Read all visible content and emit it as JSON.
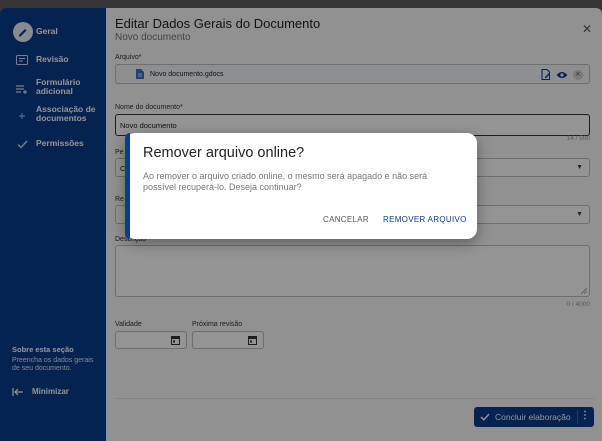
{
  "sidebar": {
    "items": [
      {
        "label": "Geral"
      },
      {
        "label": "Revisão"
      },
      {
        "label_line1": "Formulário",
        "label_line2": "adicional"
      },
      {
        "label_line1": "Associação de",
        "label_line2": "documentos"
      },
      {
        "label": "Permissões"
      }
    ],
    "about_title": "Sobre esta seção",
    "about_text": "Preencha os dados gerais de seu documento.",
    "minimize_label": "Minimizar"
  },
  "panel": {
    "title": "Editar Dados Gerais do Documento",
    "subtitle": "Novo documento",
    "close_icon": "close-icon",
    "fields": {
      "arquivo_label": "Arquivo*",
      "arquivo_value": "Novo documento.gdocs",
      "nome_label": "Nome do documento*",
      "nome_value": "Novo documento",
      "nome_counter": "14 / 500",
      "perfil_label": "Pe",
      "perfil_value": "C",
      "responsavel_label": "Re",
      "descricao_label": "Descrição",
      "descricao_counter": "0 / 4000",
      "validade_label": "Validade",
      "proxima_label": "Próxima revisão"
    },
    "complete_button": "Concluir elaboração"
  },
  "dialog": {
    "title": "Remover arquivo online?",
    "text": "Ao remover o arquivo criado online, o mesmo será apagado e não será possível recuperá-lo. Deseja continuar?",
    "cancel": "CANCELAR",
    "confirm": "REMOVER ARQUIVO"
  },
  "colors": {
    "brand": "#0a3d8c",
    "scrim": "rgba(0,0,0,0.42)"
  }
}
